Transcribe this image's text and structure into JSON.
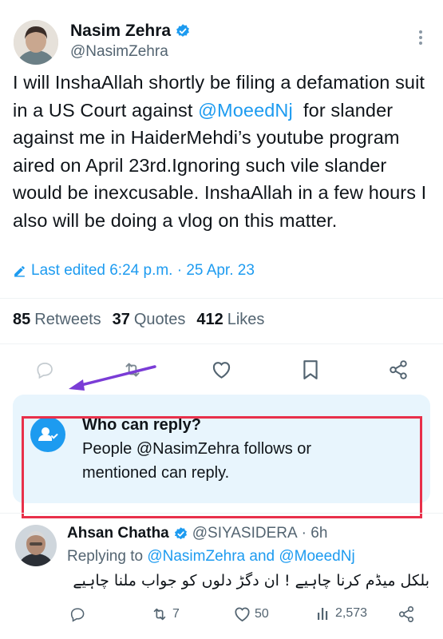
{
  "author": {
    "name": "Nasim Zehra",
    "handle": "@NasimZehra",
    "verified": true
  },
  "tweet": {
    "segments": [
      {
        "text": "I will InshaAllah shortly be filing a defamation suit in a US Court against ",
        "type": "text"
      },
      {
        "text": "@MoeedNj",
        "type": "mention"
      },
      {
        "text": "  for slander against me in HaiderMehdi’s youtube program aired on April 23rd.Ignoring such vile slander would be inexcusable. InshaAllah in a few hours I also will be doing a vlog on this matter.",
        "type": "text"
      }
    ],
    "edited_label": "Last edited 6:24 p.m. · 25 Apr. 23"
  },
  "stats": {
    "retweets_count": "85",
    "retweets_label": "Retweets",
    "quotes_count": "37",
    "quotes_label": "Quotes",
    "likes_count": "412",
    "likes_label": "Likes"
  },
  "reply_restriction": {
    "title": "Who can reply?",
    "line1": "People @NasimZehra follows or",
    "line2": "mentioned can reply."
  },
  "reply": {
    "name": "Ahsan Chatha",
    "handle": "@SIYASIDERA",
    "time": "· 6h",
    "replying_prefix": "Replying to",
    "replying_to": "@NasimZehra and @MoeedNj",
    "text": "بلکل میڈم کرنا چاہیے ! ان دگڑ دلوں کو جواب ملنا چاہیے",
    "retweets": "7",
    "likes": "50",
    "views": "2,573"
  },
  "colors": {
    "accent": "#1d9bf0",
    "annotation_red": "#e8304a",
    "annotation_arrow": "#7a3cd6"
  },
  "icons": [
    "verified-badge-icon",
    "more-icon",
    "edit-pencil-icon",
    "reply-icon",
    "retweet-icon",
    "like-icon",
    "bookmark-icon",
    "share-icon",
    "people-check-icon",
    "views-icon"
  ]
}
